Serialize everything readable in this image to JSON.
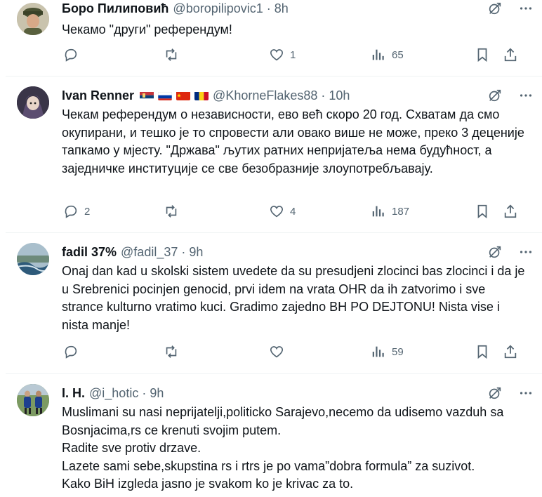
{
  "tweets": [
    {
      "name": "Боро Пилиповић",
      "handle": "@boropilipovic1",
      "separator": "·",
      "time": "8h",
      "text": "Чекамо \"други\" референдум!",
      "flags": [],
      "replies": "",
      "retweets": "",
      "likes": "1",
      "views": "65"
    },
    {
      "name": "Ivan Renner",
      "handle": "@KhorneFlakes88",
      "separator": "·",
      "time": "10h",
      "text": "Чекам референдум о независности, ево већ скоро 20 год. Схватам да смо окупирани, и тешко је то спровести али овако више не може, преко 3 деценије тапкамо у мјесту. \"Држава\" љутих ратних непријатеља нема будућност, а заједничке институције се све безобразније злоупотребљавају.",
      "flags": [
        "serbia-flag",
        "russia-flag",
        "china-flag",
        "romania-flag"
      ],
      "replies": "2",
      "retweets": "",
      "likes": "4",
      "views": "187"
    },
    {
      "name": "fadil 37%",
      "handle": "@fadil_37",
      "separator": "·",
      "time": "9h",
      "text": "Onaj dan kad u skolski sistem uvedete da su presudjeni zlocinci bas zlocinci i da je u Srebrenici pocinjen genocid, prvi idem na vrata OHR da ih zatvorimo i sve strance kulturno vratimo kuci. Gradimo zajedno BH PO DEJTONU! Nista vise i nista manje!",
      "flags": [],
      "replies": "",
      "retweets": "",
      "likes": "",
      "views": "59"
    },
    {
      "name": "I. H.",
      "handle": "@i_hotic",
      "separator": "·",
      "time": "9h",
      "text": "Muslimani su nasi neprijatelji,politicko Sarajevo,necemo da udisemo vazduh sa Bosnjacima,rs ce krenuti svojim putem.\nRadite sve protiv drzave.\nLazete sami sebe,skupstina rs i rtrs je po vama”dobra formula” za suzivot.\nKako BiH izgleda jasno je svakom ko je krivac za to.",
      "flags": []
    }
  ],
  "colors": {
    "text": "#0f1419",
    "muted": "#536471",
    "divider": "#eff3f4"
  },
  "icons": {
    "grok": "grok-icon",
    "more": "more-icon",
    "reply": "reply-icon",
    "retweet": "retweet-icon",
    "like": "like-icon",
    "views": "views-icon",
    "bookmark": "bookmark-icon",
    "share": "share-icon"
  }
}
